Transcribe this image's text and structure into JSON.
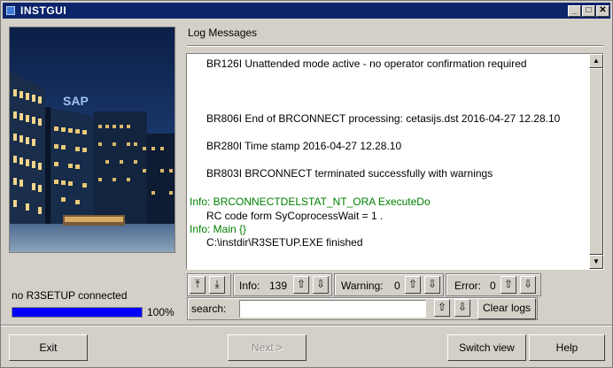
{
  "window": {
    "title": "INSTGUI",
    "controls": {
      "minimize": "_",
      "maximize": "□",
      "close": "✕"
    }
  },
  "left_panel": {
    "image_sign_text": "SAP",
    "connection_status": "no R3SETUP connected",
    "progress": {
      "value": 1.0,
      "label": "100%",
      "color": "#0000ff"
    }
  },
  "log": {
    "heading": "Log Messages",
    "lines": [
      {
        "text": "BR126I Unattended mode active - no operator confirmation required",
        "kind": "normal"
      },
      {
        "text": "BR806I End of BRCONNECT processing: cetasijs.dst 2016-04-27 12.28.10",
        "kind": "normal"
      },
      {
        "text": "BR280I Time stamp 2016-04-27 12.28.10",
        "kind": "normal"
      },
      {
        "text": "BR803I BRCONNECT terminated successfully with warnings",
        "kind": "normal"
      },
      {
        "text": "Info: BRCONNECTDELSTAT_NT_ORA ExecuteDo",
        "kind": "info"
      },
      {
        "text": "RC code form SyCoprocessWait  = 1 .",
        "kind": "normal"
      },
      {
        "text": "Info: Main {}",
        "kind": "info"
      },
      {
        "text": "C:\\instdir\\R3SETUP.EXE finished",
        "kind": "normal"
      }
    ],
    "colors": {
      "info": "#008000",
      "normal": "#000000"
    }
  },
  "toolbar": {
    "info_label": "Info:",
    "info_count": "139",
    "warning_label": "Warning:",
    "warning_count": "0",
    "error_label": "Error:",
    "error_count": "0",
    "up_arrow": "⇧",
    "down_arrow": "⇩",
    "top_arrow": "⤒",
    "bottom_arrow": "⤓"
  },
  "search": {
    "label": "search:",
    "value": "",
    "clear_label": "Clear logs"
  },
  "buttons": {
    "exit": "Exit",
    "next": "Next >",
    "switch_view": "Switch view",
    "help": "Help"
  }
}
